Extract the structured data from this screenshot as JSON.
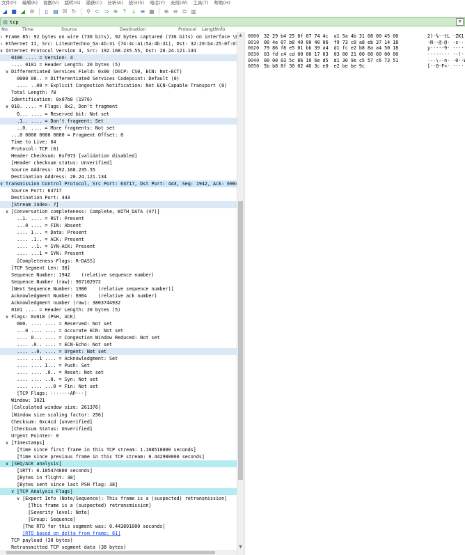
{
  "menu": [
    "文件(F)",
    "编辑(E)",
    "视图(V)",
    "跳转(G)",
    "捕获(C)",
    "分析(A)",
    "统计(S)",
    "电话(Y)",
    "无线(W)",
    "工具(T)",
    "帮助(H)"
  ],
  "toolbar": {
    "icons": [
      {
        "name": "shark-fin-start-icon",
        "glyph": "◢",
        "cls": "tb"
      },
      {
        "name": "stop-capture-icon",
        "glyph": "■",
        "cls": "tb"
      },
      {
        "name": "restart-capture-icon",
        "glyph": "◢",
        "cls": "tb green"
      },
      {
        "name": "capture-options-icon",
        "glyph": "⚙",
        "cls": "tb gray"
      },
      {
        "name": "sep",
        "glyph": "",
        "cls": "tb sep"
      },
      {
        "name": "open-file-icon",
        "glyph": "▯",
        "cls": "tb"
      },
      {
        "name": "save-file-icon",
        "glyph": "▤",
        "cls": "tb"
      },
      {
        "name": "close-file-icon",
        "glyph": "☒",
        "cls": "tb gray"
      },
      {
        "name": "reload-icon",
        "glyph": "↻",
        "cls": "tb gray"
      },
      {
        "name": "sep",
        "glyph": "",
        "cls": "tb sep"
      },
      {
        "name": "find-packet-icon",
        "glyph": "⚲",
        "cls": "tb gray"
      },
      {
        "name": "go-back-icon",
        "glyph": "⇐",
        "cls": "tb green"
      },
      {
        "name": "go-forward-icon",
        "glyph": "⇒",
        "cls": "tb green"
      },
      {
        "name": "go-to-packet-icon",
        "glyph": "≋",
        "cls": "tb green"
      },
      {
        "name": "first-packet-icon",
        "glyph": "⤒",
        "cls": "tb green"
      },
      {
        "name": "last-packet-icon",
        "glyph": "⤓",
        "cls": "tb green"
      },
      {
        "name": "auto-scroll-icon",
        "glyph": "≡",
        "cls": "tb"
      },
      {
        "name": "colorize-icon",
        "glyph": "▦",
        "cls": "tb gray"
      },
      {
        "name": "sep",
        "glyph": "",
        "cls": "tb sep"
      },
      {
        "name": "zoom-in-icon",
        "glyph": "⊕",
        "cls": "tb gray"
      },
      {
        "name": "zoom-out-icon",
        "glyph": "⊖",
        "cls": "tb gray"
      },
      {
        "name": "normal-size-icon",
        "glyph": "⊜",
        "cls": "tb gray"
      },
      {
        "name": "resize-columns-icon",
        "glyph": "▥",
        "cls": "tb gray"
      }
    ]
  },
  "filter": {
    "value": "tcp"
  },
  "columns": [
    "No.",
    "Time",
    "Source",
    "Destination",
    "Protocol",
    "Length",
    "Info"
  ],
  "detail_rows": [
    {
      "t": "› Frame 85: 92 bytes on wire (736 bits), 92 bytes captured (736 bits) on interface \\De"
    },
    {
      "t": "› Ethernet II, Src: LiteonTechno_5a:4b:31 (74:4c:a1:5a:4b:31), Dst: 32:29:b4:25:0f:07"
    },
    {
      "t": "∨ Internet Protocol Version 4, Src: 192.168.235.55, Dst: 20.24.121.134"
    },
    {
      "t": "    0100 .... = Version: 4",
      "hl": "hl-sel"
    },
    {
      "t": "    .... 0101 = Header Length: 20 bytes (5)"
    },
    {
      "t": "  ∨ Differentiated Services Field: 0x00 (DSCP: CS0, ECN: Not-ECT)"
    },
    {
      "t": "      0000 00.. = Differentiated Services Codepoint: Default (0)"
    },
    {
      "t": "      .... ..00 = Explicit Congestion Notification: Not ECN-Capable Transport (0)"
    },
    {
      "t": "    Total Length: 78"
    },
    {
      "t": "    Identification: 0x07b8 (1976)"
    },
    {
      "t": "  ∨ 010. .... = Flags: 0x2, Don't fragment"
    },
    {
      "t": "      0... .... = Reserved bit: Not set"
    },
    {
      "t": "      .1.. .... = Don't fragment: Set",
      "hl": "hl-sel"
    },
    {
      "t": "      ..0. .... = More fragments: Not set"
    },
    {
      "t": "    ...0 0000 0000 0000 = Fragment Offset: 0"
    },
    {
      "t": "    Time to Live: 64"
    },
    {
      "t": "    Protocol: TCP (6)"
    },
    {
      "t": "    Header Checksum: 0xf973 [validation disabled]"
    },
    {
      "t": "    [Header checksum status: Unverified]"
    },
    {
      "t": "    Source Address: 192.168.235.55"
    },
    {
      "t": "    Destination Address: 20.24.121.134"
    },
    {
      "t": "∨ Transmission Control Protocol, Src Port: 63717, Dst Port: 443, Seq: 1942, Ack: 6904,",
      "hl": "hl-blue"
    },
    {
      "t": "    Source Port: 63717"
    },
    {
      "t": "    Destination Port: 443"
    },
    {
      "t": "    [Stream index: 7]",
      "hl": "hl-sel"
    },
    {
      "t": "  ∨ [Conversation completeness: Complete, WITH_DATA (47)]"
    },
    {
      "t": "      ..1. .... = RST: Present"
    },
    {
      "t": "      ...0 .... = FIN: Absent"
    },
    {
      "t": "      .... 1... = Data: Present"
    },
    {
      "t": "      .... .1.. = ACK: Present"
    },
    {
      "t": "      .... ..1. = SYN-ACK: Present"
    },
    {
      "t": "      .... ...1 = SYN: Present"
    },
    {
      "t": "      [Completeness Flags: R-DASS]"
    },
    {
      "t": "    [TCP Segment Len: 38]"
    },
    {
      "t": "    Sequence Number: 1942    (relative sequence number)"
    },
    {
      "t": "    Sequence Number (raw): 967102972"
    },
    {
      "t": "    [Next Sequence Number: 1980    (relative sequence number)]"
    },
    {
      "t": "    Acknowledgment Number: 6904    (relative ack number)"
    },
    {
      "t": "    Acknowledgment number (raw): 3803744932"
    },
    {
      "t": "    0101 .... = Header Length: 20 bytes (5)"
    },
    {
      "t": "  ∨ Flags: 0x018 (PSH, ACK)"
    },
    {
      "t": "      000. .... .... = Reserved: Not set"
    },
    {
      "t": "      ...0 .... .... = Accurate ECN: Not set"
    },
    {
      "t": "      .... 0... .... = Congestion Window Reduced: Not set"
    },
    {
      "t": "      .... .0.. .... = ECN-Echo: Not set"
    },
    {
      "t": "      .... ..0. .... = Urgent: Not set",
      "hl": "hl-sel"
    },
    {
      "t": "      .... ...1 .... = Acknowledgment: Set"
    },
    {
      "t": "      .... .... 1... = Push: Set"
    },
    {
      "t": "      .... .... .0.. = Reset: Not set"
    },
    {
      "t": "      .... .... ..0. = Syn: Not set"
    },
    {
      "t": "      .... .... ...0 = Fin: Not set"
    },
    {
      "t": "      [TCP Flags: ·······AP···]"
    },
    {
      "t": "    Window: 1021"
    },
    {
      "t": "    [Calculated window size: 261376]"
    },
    {
      "t": "    [Window size scaling factor: 256]"
    },
    {
      "t": "    Checksum: 0xc4cd [unverified]"
    },
    {
      "t": "    [Checksum Status: Unverified]"
    },
    {
      "t": "    Urgent Pointer: 0"
    },
    {
      "t": "  ∨ [Timestamps]"
    },
    {
      "t": "      [Time since first frame in this TCP stream: 1.108510000 seconds]"
    },
    {
      "t": "      [Time since previous frame in this TCP stream: 0.442980000 seconds]"
    },
    {
      "t": "  ∨ [SEQ/ACK analysis]",
      "hl": "hl-cyan"
    },
    {
      "t": "      [iRTT: 0.185474000 seconds]"
    },
    {
      "t": "      [Bytes in flight: 38]"
    },
    {
      "t": "      [Bytes sent since last PSH flag: 38]"
    },
    {
      "t": "    ∨ [TCP Analysis Flags]",
      "hl": "hl-cyan"
    },
    {
      "t": "      ∨ [Expert Info (Note/Sequence): This frame is a (suspected) retransmission]"
    },
    {
      "t": "          [This frame is a (suspected) retransmission]"
    },
    {
      "t": "          [Severity level: Note]"
    },
    {
      "t": "          [Group: Sequence]"
    },
    {
      "t": "        [The RTO for this segment was: 0.443891000 seconds]"
    },
    {
      "t": "        ",
      "link": "[RTO based on delta from frame: 81]"
    },
    {
      "t": "    TCP payload (38 bytes)"
    },
    {
      "t": "    Retransmitted TCP segment data (38 bytes)"
    }
  ],
  "bytes_rows": [
    {
      "off": "0000",
      "hex": "32 29 b4 25 0f 07 74 4c  a1 5a 4b 31 08 00 45 00",
      "asc": "2)·%··tL ·ZK1··E·"
    },
    {
      "off": "0010",
      "hex": "00 4e 07 b8 40 00 40 06  f9 73 c0 a8 eb 37 14 18",
      "asc": "·N··@·@· ·s···7··"
    },
    {
      "off": "0020",
      "hex": "79 86 f8 e5 01 bb 39 a4  d1 fc e2 b8 8a a4 50 18",
      "asc": "y·····9· ······P·"
    },
    {
      "off": "0030",
      "hex": "03 fd c4 cd 00 00 17 03  03 00 21 00 00 00 00 00",
      "asc": "········ ··!·····"
    },
    {
      "off": "0040",
      "hex": "00 00 03 5c 86 10 6e d5  d1 30 9e c5 57 c6 73 51",
      "asc": "···\\··n· ·0··W·sQ"
    },
    {
      "off": "0050",
      "hex": "5b b8 8f 30 02 46 3c e0  e2 be be 9c",
      "asc": "[··0·F<· ····"
    }
  ]
}
